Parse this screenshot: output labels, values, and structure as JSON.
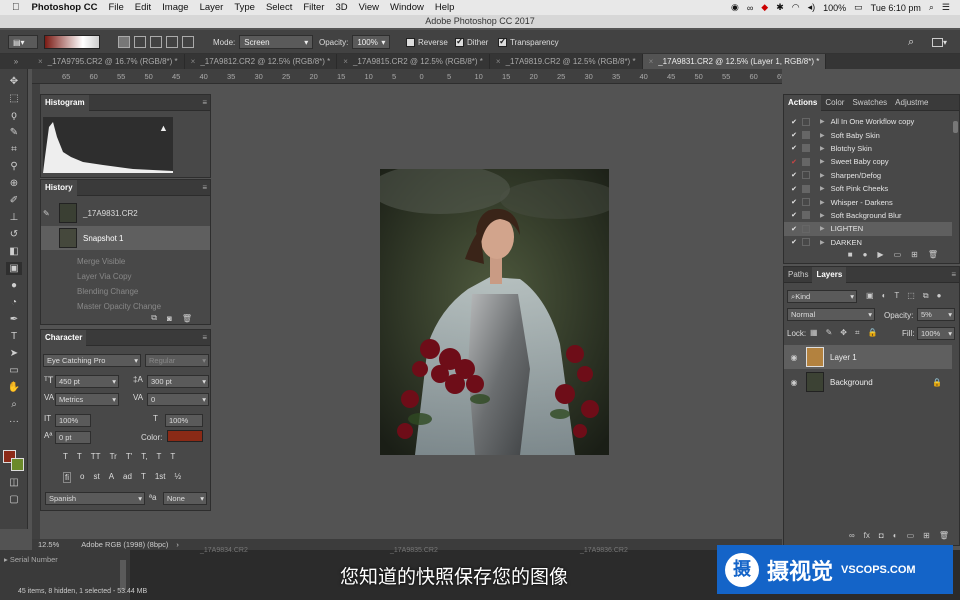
{
  "menubar": {
    "app": "Photoshop CC",
    "items": [
      "File",
      "Edit",
      "Image",
      "Layer",
      "Type",
      "Select",
      "Filter",
      "3D",
      "View",
      "Window",
      "Help"
    ],
    "battery": "100%",
    "clock": "Tue 6:10 pm"
  },
  "window_title": "Adobe Photoshop CC 2017",
  "options": {
    "mode_label": "Mode:",
    "mode_value": "Screen",
    "opacity_label": "Opacity:",
    "opacity_value": "100%",
    "reverse": "Reverse",
    "dither": "Dither",
    "transparency": "Transparency"
  },
  "tabs": [
    "_17A9795.CR2 @ 16.7% (RGB/8*) *",
    "_17A9812.CR2 @ 12.5% (RGB/8*) *",
    "_17A9815.CR2 @ 12.5% (RGB/8*) *",
    "_17A9819.CR2 @ 12.5% (RGB/8*) *",
    "_17A9831.CR2 @ 12.5% (Layer 1, RGB/8*) *"
  ],
  "ruler": [
    "65",
    "60",
    "55",
    "50",
    "45",
    "40",
    "35",
    "30",
    "25",
    "20",
    "15",
    "10",
    "5",
    "0",
    "5",
    "10",
    "15",
    "20",
    "25",
    "30",
    "35",
    "40",
    "45",
    "50",
    "55",
    "60",
    "65",
    "70"
  ],
  "histogram": {
    "title": "Histogram"
  },
  "history": {
    "title": "History",
    "snapshot_name": "_17A9831.CR2",
    "snapshot1": "Snapshot 1",
    "steps": [
      "Merge Visible",
      "Layer Via Copy",
      "Blending Change",
      "Master Opacity Change"
    ]
  },
  "character": {
    "title": "Character",
    "font": "Eye Catching Pro",
    "style": "Regular",
    "size": "450 pt",
    "leading": "300 pt",
    "kerning": "Metrics",
    "tracking": "0",
    "vscale": "100%",
    "hscale": "100%",
    "baseline": "0 pt",
    "color_label": "Color:",
    "color": "#8a2a16",
    "language": "Spanish",
    "aa_label": "a",
    "aa": "None",
    "type_buttons": [
      "T",
      "T",
      "TT",
      "Tr",
      "T'",
      "T,",
      "T",
      "T"
    ],
    "ot_buttons": [
      "fi",
      "o",
      "st",
      "A",
      "ad",
      "T",
      "1st",
      "½"
    ]
  },
  "status": {
    "zoom": "12.5%",
    "profile": "Adobe RGB (1998) (8bpc)"
  },
  "actions": {
    "tabs": [
      "Actions",
      "Color",
      "Swatches",
      "Adjustme"
    ],
    "items": [
      "All In One Workflow copy",
      "Soft Baby Skin",
      "Blotchy Skin",
      "Sweet Baby copy",
      "Sharpen/Defog",
      "Soft Pink Cheeks",
      "Whisper - Darkens",
      "Soft Background Blur",
      "LIGHTEN",
      "DARKEN"
    ]
  },
  "layers": {
    "tabs": [
      "Paths",
      "Layers"
    ],
    "filter": "Kind",
    "blend": "Normal",
    "opacity_label": "Opacity:",
    "opacity": "5%",
    "lock_label": "Lock:",
    "fill_label": "Fill:",
    "fill": "100%",
    "items": [
      "Layer 1",
      "Background"
    ]
  },
  "bottom": {
    "serial": "Serial Number",
    "filmstrip": [
      "_17A9834.CR2",
      "_17A9835.CR2",
      "_17A9836.CR2"
    ],
    "items_info": "45 items, 8 hidden, 1 selected - 53.44 MB"
  },
  "subtitle": "您知道的快照保存您的图像",
  "logo": {
    "mark": "摄",
    "cn": "摄视觉",
    "en": "VSCOPS.COM"
  },
  "colors": {
    "fg": "#8c2a17",
    "bg": "#6b8a2a"
  }
}
